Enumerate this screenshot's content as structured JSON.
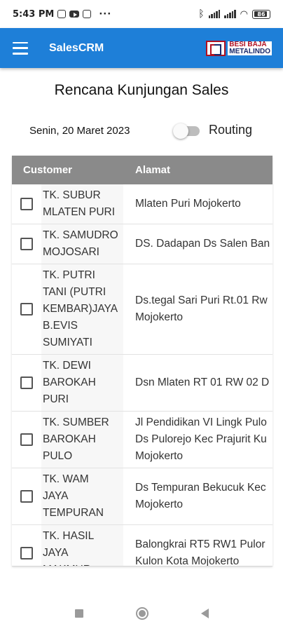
{
  "status_bar": {
    "time": "5:43 PM",
    "dots": "···",
    "battery": "86"
  },
  "app_bar": {
    "title": "SalesCRM",
    "brand_line1": "BESI BAJA",
    "brand_line2": "METALINDO",
    "brand_color": "#b01020",
    "bar_color": "#1e7fd8"
  },
  "page": {
    "title": "Rencana Kunjungan Sales",
    "date": "Senin, 20 Maret 2023",
    "routing_label": "Routing",
    "routing_enabled": false
  },
  "table": {
    "headers": {
      "customer": "Customer",
      "alamat": "Alamat"
    },
    "rows": [
      {
        "customer": "TK. SUBUR\nMLATEN PURI",
        "alamat": "Mlaten Puri Mojokerto",
        "checked": false
      },
      {
        "customer": "TK. SAMUDRO\nMOJOSARI",
        "alamat": "DS. Dadapan Ds Salen Ban",
        "checked": false
      },
      {
        "customer": "TK. PUTRI\nTANI (PUTRI\nKEMBAR)JAYA\nB.EVIS\nSUMIYATI",
        "alamat": "Ds.tegal Sari Puri Rt.01 Rw\nMojokerto",
        "checked": false
      },
      {
        "customer": "TK. DEWI\nBAROKAH\nPURI",
        "alamat": "Dsn Mlaten RT 01 RW 02 D",
        "checked": false
      },
      {
        "customer": "TK. SUMBER\nBAROKAH\nPULO",
        "alamat": "Jl Pendidikan VI Lingk Pulo\nDs Pulorejo Kec Prajurit Ku\nMojokerto",
        "checked": false
      },
      {
        "customer": "TK. WAM\nJAYA\nTEMPURAN",
        "alamat": "Ds Tempuran Bekucuk Kec\nMojokerto",
        "checked": false
      },
      {
        "customer": "TK. HASIL\nJAYA\nMAKMUR",
        "alamat": "Balongkrai RT5 RW1 Pulor\nKulon Kota Mojokerto",
        "checked": false
      }
    ]
  }
}
